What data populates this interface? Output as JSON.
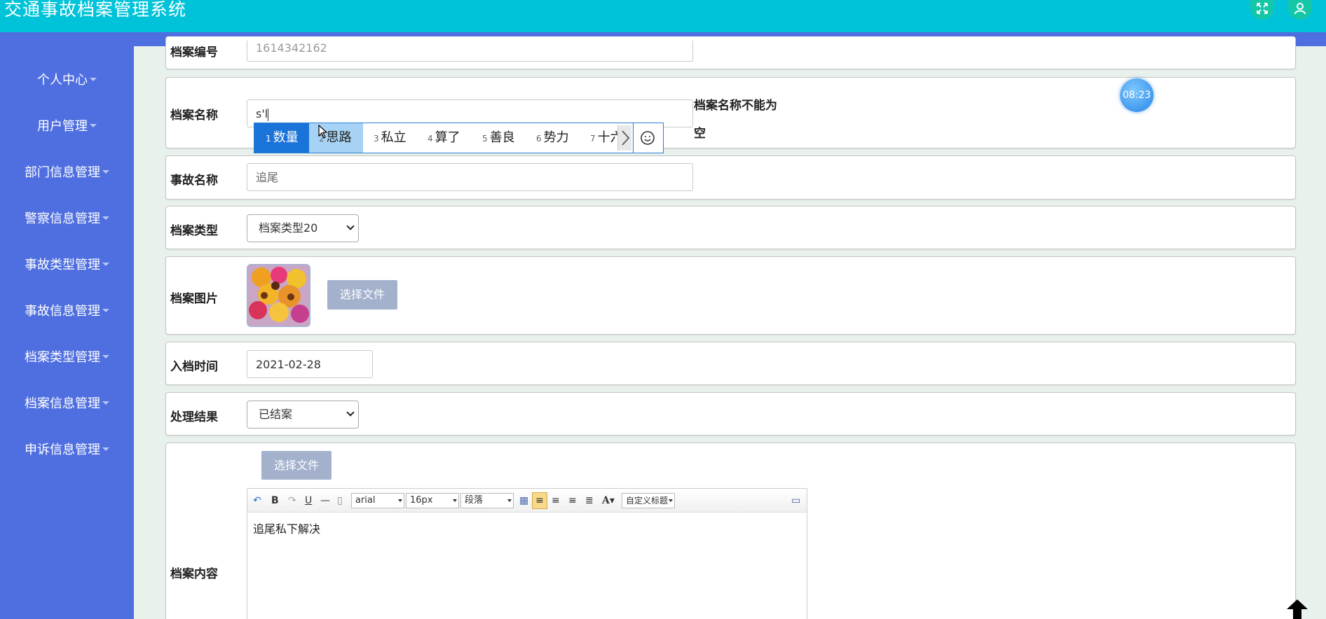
{
  "app": {
    "title": "交通事故档案管理系统",
    "accent_color": "#00c3d9",
    "sidebar_color": "#4f6fe0",
    "top_icons": [
      "fullscreen-icon",
      "user-icon"
    ]
  },
  "sidebar": {
    "items": [
      {
        "label": "个人中心"
      },
      {
        "label": "用户管理"
      },
      {
        "label": "部门信息管理"
      },
      {
        "label": "警察信息管理"
      },
      {
        "label": "事故类型管理"
      },
      {
        "label": "事故信息管理"
      },
      {
        "label": "档案类型管理"
      },
      {
        "label": "档案信息管理"
      },
      {
        "label": "申诉信息管理"
      }
    ]
  },
  "form": {
    "archive_no": {
      "label": "档案编号",
      "value": "1614342162"
    },
    "archive_name": {
      "label": "档案名称",
      "value": "s'l",
      "error": "档案名称不能为空"
    },
    "accident_name": {
      "label": "事故名称",
      "value": "追尾"
    },
    "archive_type": {
      "label": "档案类型",
      "value": "档案类型20"
    },
    "archive_image": {
      "label": "档案图片",
      "button": "选择文件"
    },
    "archive_time": {
      "label": "入档时间",
      "value": "2021-02-28"
    },
    "result": {
      "label": "处理结果",
      "value": "已结案"
    },
    "content": {
      "label": "档案内容",
      "button": "选择文件",
      "font": "arial",
      "size": "16px",
      "paragraph": "段落",
      "custom_title": "自定义标题",
      "text": "追尾私下解决"
    }
  },
  "ime": {
    "candidates": [
      {
        "num": "1",
        "text": "数量"
      },
      {
        "num": "2",
        "text": "思路"
      },
      {
        "num": "3",
        "text": "私立"
      },
      {
        "num": "4",
        "text": "算了"
      },
      {
        "num": "5",
        "text": "善良"
      },
      {
        "num": "6",
        "text": "势力"
      },
      {
        "num": "7",
        "text": "十六"
      }
    ],
    "emoji_icon": "smiley-icon"
  },
  "timer": "08:23"
}
